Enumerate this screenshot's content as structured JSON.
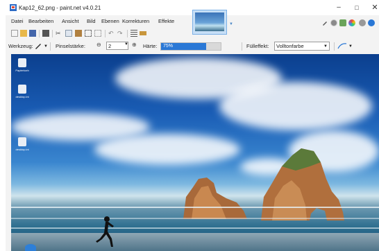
{
  "window": {
    "title": "Kap12_62.png - paint.net v4.0.21",
    "controls": {
      "minimize": "–",
      "maximize": "□",
      "close": "✕"
    }
  },
  "menu": {
    "items": [
      {
        "label": "Datei"
      },
      {
        "label": "Bearbeiten"
      },
      {
        "label": "Ansicht"
      },
      {
        "label": "Bild"
      },
      {
        "label": "Ebenen"
      },
      {
        "label": "Korrekturen"
      },
      {
        "label": "Effekte"
      }
    ]
  },
  "toolbar_icons": [
    "new-icon",
    "open-icon",
    "save-icon",
    "print-icon",
    "cut-icon",
    "copy-icon",
    "paste-icon",
    "crop-icon",
    "deselect-icon",
    "undo-icon",
    "redo-icon",
    "grid-icon",
    "ruler-icon"
  ],
  "right_toolbar_icons": [
    "tools-icon",
    "history-icon",
    "layers-icon",
    "colors-icon",
    "settings-icon",
    "help-icon"
  ],
  "tool_options": {
    "tool_label": "Werkzeug:",
    "brush_width_label": "Pinselstärke:",
    "brush_width_value": "2",
    "hardness_label": "Härte:",
    "hardness_value": "75%",
    "hardness_fraction": 0.75,
    "fill_label": "Fülleffekt:",
    "fill_value": "Volltonfarbe"
  },
  "desktop_icons": [
    {
      "label": "Papierkorb"
    },
    {
      "label": "desktop.ini"
    },
    {
      "label": "desktop.ini"
    }
  ],
  "colors": {
    "accent": "#2a78d6",
    "hardness_track": "#d9d9d9"
  }
}
